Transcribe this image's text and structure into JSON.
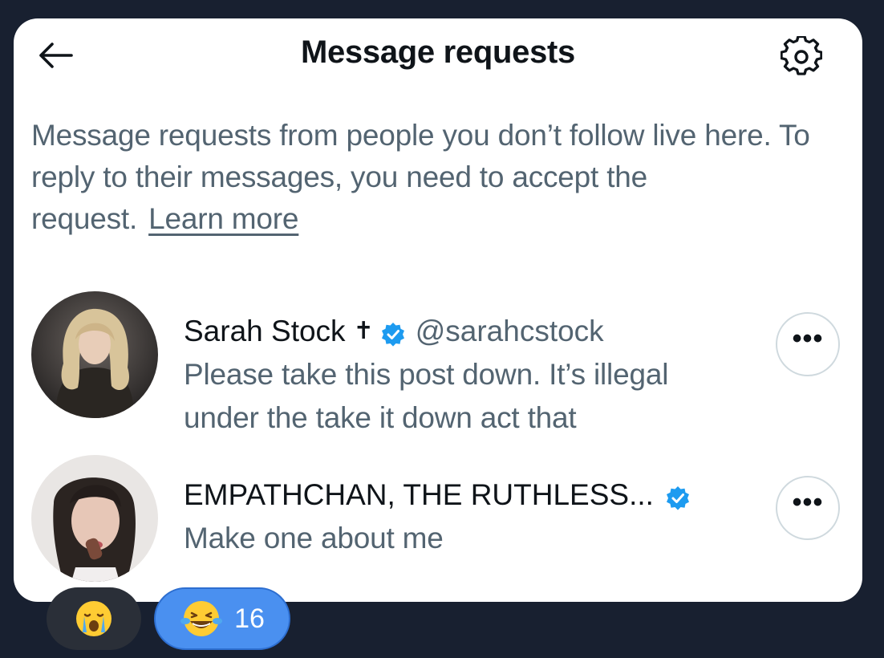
{
  "header": {
    "title": "Message requests",
    "back_icon": "arrow-left-icon",
    "settings_icon": "gear-icon"
  },
  "description": {
    "text": "Message requests from people you don’t follow live here. To reply to their messages, you need to accept the request.",
    "link": "Learn more"
  },
  "requests": [
    {
      "name": "Sarah Stock",
      "symbol": "✝",
      "verified": true,
      "handle": "@sarahcstock",
      "preview_line1": "Please take this post down. It’s illegal",
      "preview_line2": "under the take it down act that",
      "more_label": "•••"
    },
    {
      "name": "EMPATHCHAN, THE RUTHLESS...",
      "verified": true,
      "preview_line1": "Make one about me",
      "more_label": "•••"
    }
  ],
  "reactions": {
    "cry_icon": "crying-face-emoji",
    "laugh_icon": "tears-of-joy-emoji",
    "laugh_count": "16"
  },
  "colors": {
    "background": "#182030",
    "card": "#ffffff",
    "verified": "#1d9bf0",
    "secondary_text": "#536471",
    "reaction_active": "#4a90f0"
  }
}
